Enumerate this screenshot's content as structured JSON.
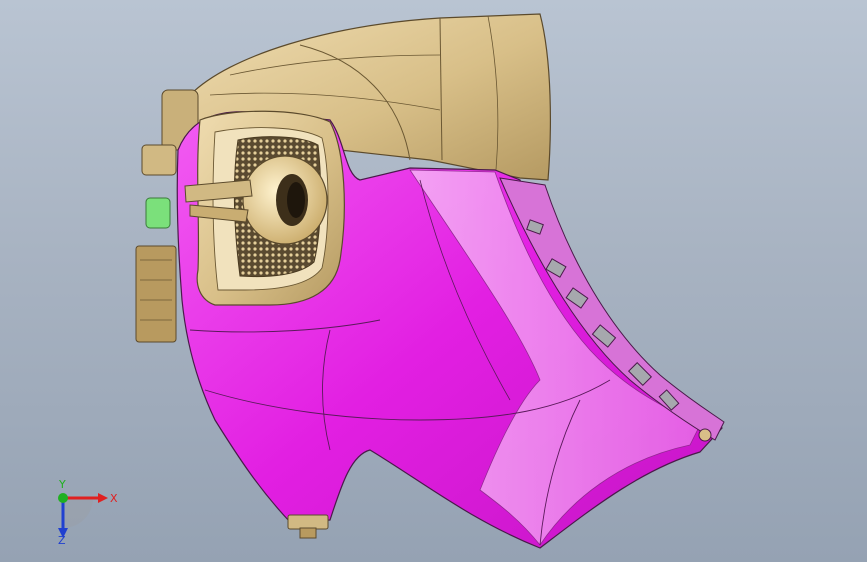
{
  "viewport": {
    "background_top": "#b9c4d2",
    "background_bottom": "#95a2b3"
  },
  "model": {
    "primary_color": "#e51ee5",
    "secondary_color": "#d9c08a",
    "grille_color": "#6e5a3a",
    "accent_color": "#7be07b"
  },
  "triad": {
    "x_label": "X",
    "y_label": "Y",
    "z_label": "Z",
    "x_color": "#e02020",
    "y_color": "#20b020",
    "z_color": "#2040d0"
  }
}
